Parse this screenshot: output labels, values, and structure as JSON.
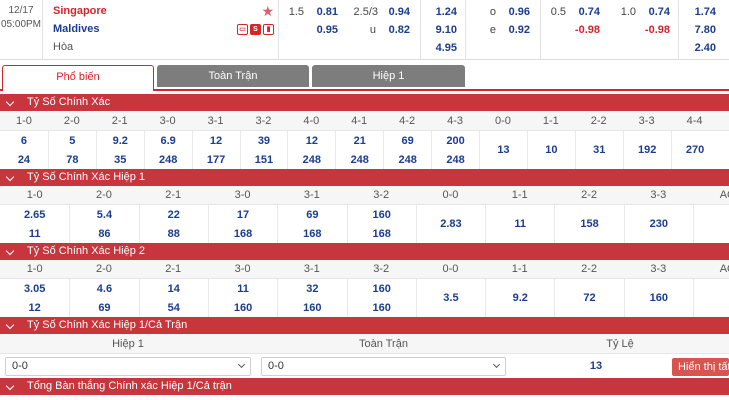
{
  "match": {
    "date": "12/17",
    "time": "05:00PM",
    "home": "Singapore",
    "away": "Maldives",
    "draw": "Hòa",
    "icon_labels": [
      "",
      "S",
      ""
    ]
  },
  "odds": {
    "hdp_line": "1.5",
    "hdp_home": "0.81",
    "hdp_away": "0.95",
    "ou_line": "2.5/3",
    "ou_over": "0.94",
    "ou_under": "0.82",
    "ou_u_label": "u",
    "x12_home": "1.24",
    "x12_away": "9.10",
    "x12_draw": "4.95",
    "oe_o_label": "o",
    "oe_e_label": "e",
    "oe_odd": "0.96",
    "oe_even": "0.92",
    "h1_hdp_line": "0.5",
    "h1_hdp_home": "0.74",
    "h1_hdp_away": "-0.98",
    "h1_ou_line": "1.0",
    "h1_ou_over": "0.74",
    "h1_ou_under": "-0.98",
    "h1_x12_home": "1.74",
    "h1_x12_away": "7.80",
    "h1_x12_draw": "2.40"
  },
  "tabs": [
    "Phổ biến",
    "Toàn Trận",
    "Hiệp 1"
  ],
  "sections": {
    "s1": "Tỷ Số Chính Xác",
    "s2": "Tỷ Số Chính Xác Hiệp 1",
    "s3": "Tỷ Số Chính Xác Hiệp 2",
    "s4": "Tỷ Số Chính Xác Hiệp 1/Cả Trận",
    "s5": "Tổng Bàn thắng Chính xác Hiệp 1/Cả trận"
  },
  "grid1": {
    "headers": [
      "1-0",
      "2-0",
      "2-1",
      "3-0",
      "3-1",
      "3-2",
      "4-0",
      "4-1",
      "4-2",
      "4-3",
      "0-0",
      "1-1",
      "2-2",
      "3-3",
      "4-4"
    ],
    "row1": [
      "6",
      "5",
      "9.2",
      "6.9",
      "12",
      "39",
      "12",
      "21",
      "69",
      "200",
      "13",
      "10",
      "31",
      "192",
      "270"
    ],
    "row2": [
      "24",
      "78",
      "35",
      "248",
      "177",
      "151",
      "248",
      "248",
      "248",
      "248",
      "",
      "",
      "",
      "",
      ""
    ]
  },
  "grid2": {
    "headers": [
      "1-0",
      "2-0",
      "2-1",
      "3-0",
      "3-1",
      "3-2",
      "0-0",
      "1-1",
      "2-2",
      "3-3",
      "AO"
    ],
    "row1": [
      "2.65",
      "5.4",
      "22",
      "17",
      "69",
      "160",
      "2.83",
      "11",
      "158",
      "230",
      ""
    ],
    "row2": [
      "11",
      "86",
      "88",
      "168",
      "168",
      "168",
      "",
      "",
      "",
      "",
      ""
    ]
  },
  "grid3": {
    "headers": [
      "1-0",
      "2-0",
      "2-1",
      "3-0",
      "3-1",
      "3-2",
      "0-0",
      "1-1",
      "2-2",
      "3-3",
      "AO"
    ],
    "row1": [
      "3.05",
      "4.6",
      "14",
      "11",
      "32",
      "160",
      "3.5",
      "9.2",
      "72",
      "160",
      ""
    ],
    "row2": [
      "12",
      "69",
      "54",
      "160",
      "160",
      "160",
      "",
      "",
      "",
      "",
      ""
    ]
  },
  "halffull": {
    "col1": "Hiệp 1",
    "col2": "Toàn Trận",
    "col3": "Tỷ Lệ",
    "sel1_value": "0-0",
    "sel2_value": "0-0",
    "rate": "13",
    "show_button": "Hiển thị tất"
  },
  "colors": {
    "accent": "#d9232a",
    "section_bg": "#c8363d",
    "odds_blue": "#1a3d8f",
    "tab_inactive": "#7d7d7d"
  }
}
